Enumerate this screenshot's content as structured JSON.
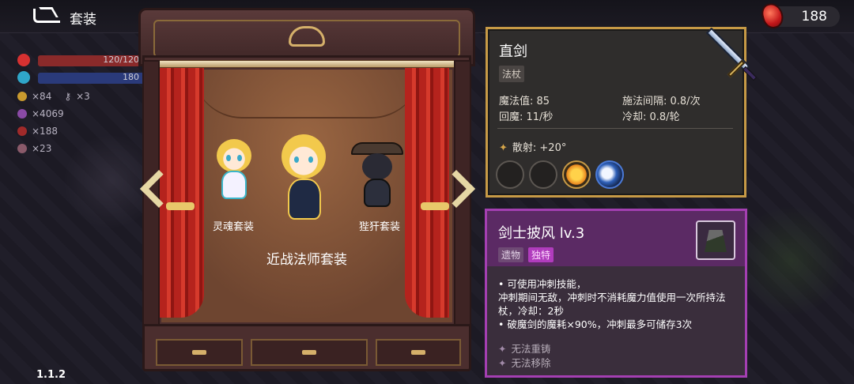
{
  "header": {
    "title": "套装",
    "currency_value": "188"
  },
  "hud": {
    "hp": "120/120",
    "mp": "180",
    "coins": "×84",
    "keys": "×3",
    "gems": "×4069",
    "red_gems": "×188",
    "tickets": "×23"
  },
  "version": "1.1.2",
  "wardrobe": {
    "characters": [
      {
        "label": "灵魂套装"
      },
      {
        "label": ""
      },
      {
        "label": "狴犴套装"
      }
    ],
    "current_set": "近战法师套装"
  },
  "weapon": {
    "name": "直剑",
    "type": "法杖",
    "stats": [
      {
        "label": "魔法值: 85"
      },
      {
        "label": "施法间隔: 0.8/次"
      },
      {
        "label": "回魔: 11/秒"
      },
      {
        "label": "冷却: 0.8/轮"
      }
    ],
    "extra": "散射: +20°",
    "slots": [
      "empty",
      "empty",
      "sun-rune",
      "moon-rune"
    ]
  },
  "relic": {
    "name": "剑士披风 lv.3",
    "tags": [
      "遗物",
      "独特"
    ],
    "description": [
      "可使用冲刺技能，",
      "冲刺期间无敌，冲刺时不消耗魔力值使用一次所持法杖，冷却：2秒",
      "破魔剑的魔耗×90%，冲刺最多可储存3次"
    ],
    "notes": [
      "无法重铸",
      "无法移除"
    ]
  },
  "colors": {
    "weapon_border": "#c79a46",
    "relic_border": "#a43fb2",
    "unique_tag": "#b03cbd"
  }
}
